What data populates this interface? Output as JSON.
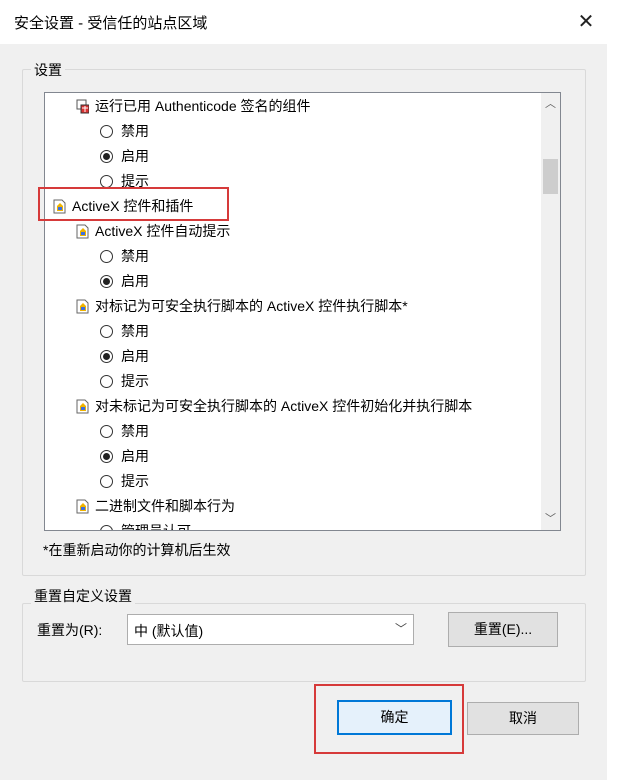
{
  "window": {
    "title": "安全设置 - 受信任的站点区域",
    "close_symbol": "✕"
  },
  "settings_group": {
    "label": "设置"
  },
  "tree": [
    {
      "kind": "item",
      "indent": 1,
      "icon": "component-icon",
      "label": "运行已用 Authenticode 签名的组件"
    },
    {
      "kind": "radio",
      "indent": 2,
      "label": "禁用",
      "checked": false
    },
    {
      "kind": "radio",
      "indent": 2,
      "label": "启用",
      "checked": true
    },
    {
      "kind": "radio",
      "indent": 2,
      "label": "提示",
      "checked": false
    },
    {
      "kind": "item",
      "indent": 0,
      "icon": "document-icon",
      "label": "ActiveX 控件和插件"
    },
    {
      "kind": "item",
      "indent": 1,
      "icon": "document-icon",
      "label": "ActiveX 控件自动提示"
    },
    {
      "kind": "radio",
      "indent": 2,
      "label": "禁用",
      "checked": false
    },
    {
      "kind": "radio",
      "indent": 2,
      "label": "启用",
      "checked": true
    },
    {
      "kind": "item",
      "indent": 1,
      "icon": "document-icon",
      "label": "对标记为可安全执行脚本的 ActiveX 控件执行脚本*"
    },
    {
      "kind": "radio",
      "indent": 2,
      "label": "禁用",
      "checked": false
    },
    {
      "kind": "radio",
      "indent": 2,
      "label": "启用",
      "checked": true
    },
    {
      "kind": "radio",
      "indent": 2,
      "label": "提示",
      "checked": false
    },
    {
      "kind": "item",
      "indent": 1,
      "icon": "document-icon",
      "label": "对未标记为可安全执行脚本的 ActiveX 控件初始化并执行脚本"
    },
    {
      "kind": "radio",
      "indent": 2,
      "label": "禁用",
      "checked": false
    },
    {
      "kind": "radio",
      "indent": 2,
      "label": "启用",
      "checked": true
    },
    {
      "kind": "radio",
      "indent": 2,
      "label": "提示",
      "checked": false
    },
    {
      "kind": "item",
      "indent": 1,
      "icon": "document-icon",
      "label": "二进制文件和脚本行为"
    },
    {
      "kind": "radio",
      "indent": 2,
      "label": "管理员认可",
      "checked": false
    }
  ],
  "scrollbar": {
    "up": "︿",
    "down": "﹀"
  },
  "note": "*在重新启动你的计算机后生效",
  "reset_group": {
    "label": "重置自定义设置",
    "reset_to_label": "重置为(R):",
    "selected_level": "中 (默认值)",
    "reset_button": "重置(E)..."
  },
  "buttons": {
    "ok": "确定",
    "cancel": "取消"
  },
  "colors": {
    "highlight": "#d63a3a",
    "accent": "#0078d7"
  }
}
